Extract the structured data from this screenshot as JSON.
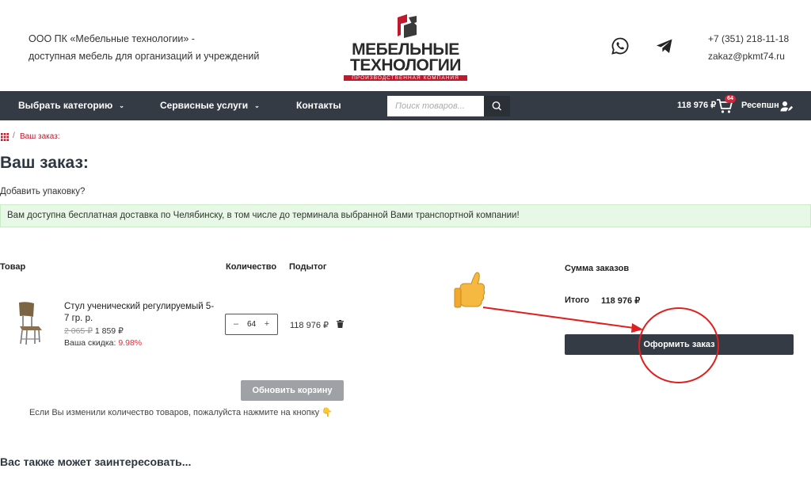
{
  "header": {
    "company_line1": "ООО ПК «Мебельные технологии» -",
    "company_line2": "доступная мебель для организаций и учреждений",
    "logo_line1": "МЕБЕЛЬНЫЕ",
    "logo_line2": "ТЕХНОЛОГИИ",
    "logo_line3": "ПРОИЗВОДСТВЕННАЯ КОМПАНИЯ",
    "phone": "+7 (351) 218-11-18",
    "email": "zakaz@pkmt74.ru"
  },
  "nav": {
    "category": "Выбрать категорию",
    "services": "Сервисные услуги",
    "contacts": "Контакты",
    "search_placeholder": "Поиск товаров...",
    "cart_total": "118 976 ₽",
    "cart_count": "64",
    "user": "Ресепшн"
  },
  "breadcrumb": {
    "separator": "/",
    "current": "Ваш заказ:"
  },
  "page": {
    "title": "Ваш заказ:",
    "add_packaging": "Добавить упаковку?",
    "notice": "Вам доступна бесплатная доставка по Челябинску, в том числе до терминала выбранной Вами транспортной компании!"
  },
  "table": {
    "headers": {
      "product": "Товар",
      "quantity": "Количество",
      "subtotal": "Подытог"
    },
    "item": {
      "name": "Стул ученический регулируемый 5-7 гр. р.",
      "old_price": "2 065 ₽",
      "price": "1 859 ₽",
      "discount_label": "Ваша скидка:",
      "discount_value": "9.98%",
      "quantity": "64",
      "minus": "–",
      "plus": "+",
      "subtotal": "118 976 ₽"
    },
    "update_button": "Обновить корзину",
    "update_hint": "Если Вы изменили количество товаров, пожалуйста нажмите на кнопку 👇"
  },
  "summary": {
    "title": "Сумма заказов",
    "total_label": "Итого",
    "total_value": "118 976 ₽",
    "checkout_button": "Оформить заказ"
  },
  "related_title": "Вас также может заинтересовать...",
  "colors": {
    "nav_bg": "#343b44",
    "brand_red": "#c0182c",
    "annotation_red": "#e02020",
    "notice_bg": "#e7f9e6"
  }
}
